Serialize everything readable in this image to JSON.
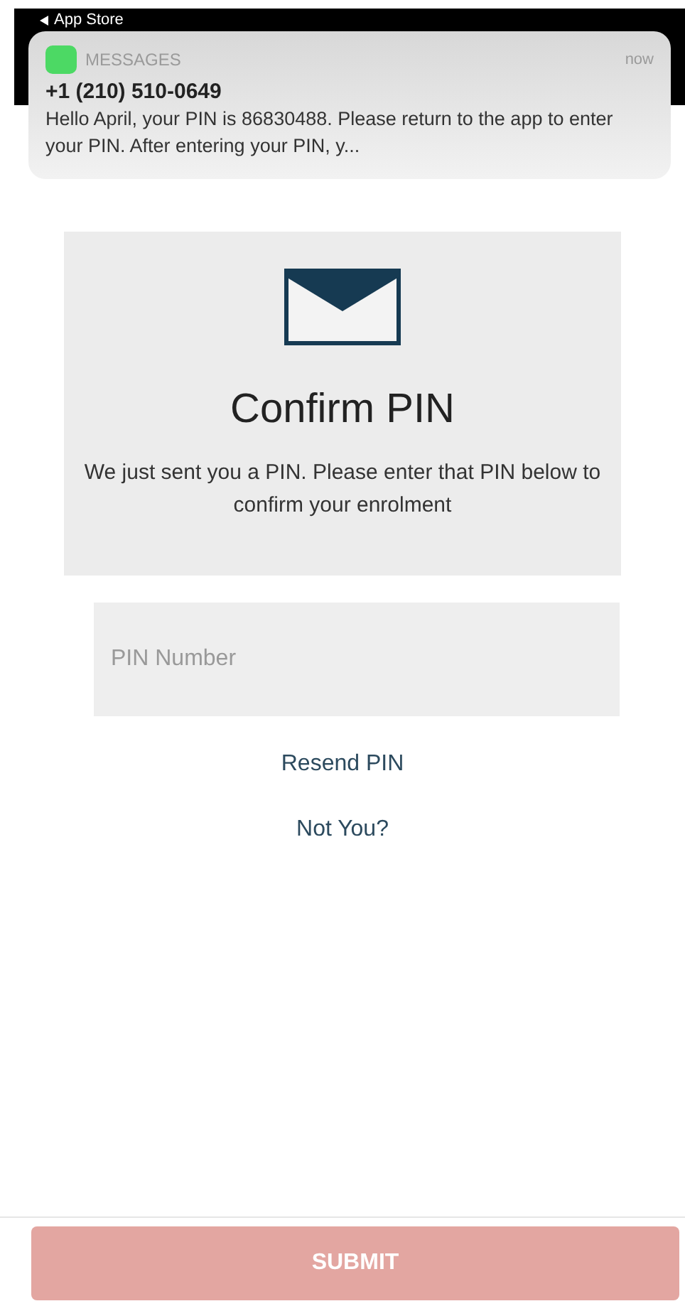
{
  "status_bar": {
    "back_label": "App Store"
  },
  "notification": {
    "app": "MESSAGES",
    "time": "now",
    "sender": "+1 (210) 510-0649",
    "body": "Hello April, your PIN is 86830488. Please return to the app to enter your PIN. After entering your PIN, y..."
  },
  "card": {
    "title": "Confirm PIN",
    "text": "We just sent you a PIN. Please enter that PIN below to confirm your enrolment"
  },
  "pin_field": {
    "placeholder": "PIN Number"
  },
  "links": [
    "Resend PIN",
    "Not You?"
  ],
  "submit": {
    "label": "SUBMIT",
    "disabled": true
  }
}
